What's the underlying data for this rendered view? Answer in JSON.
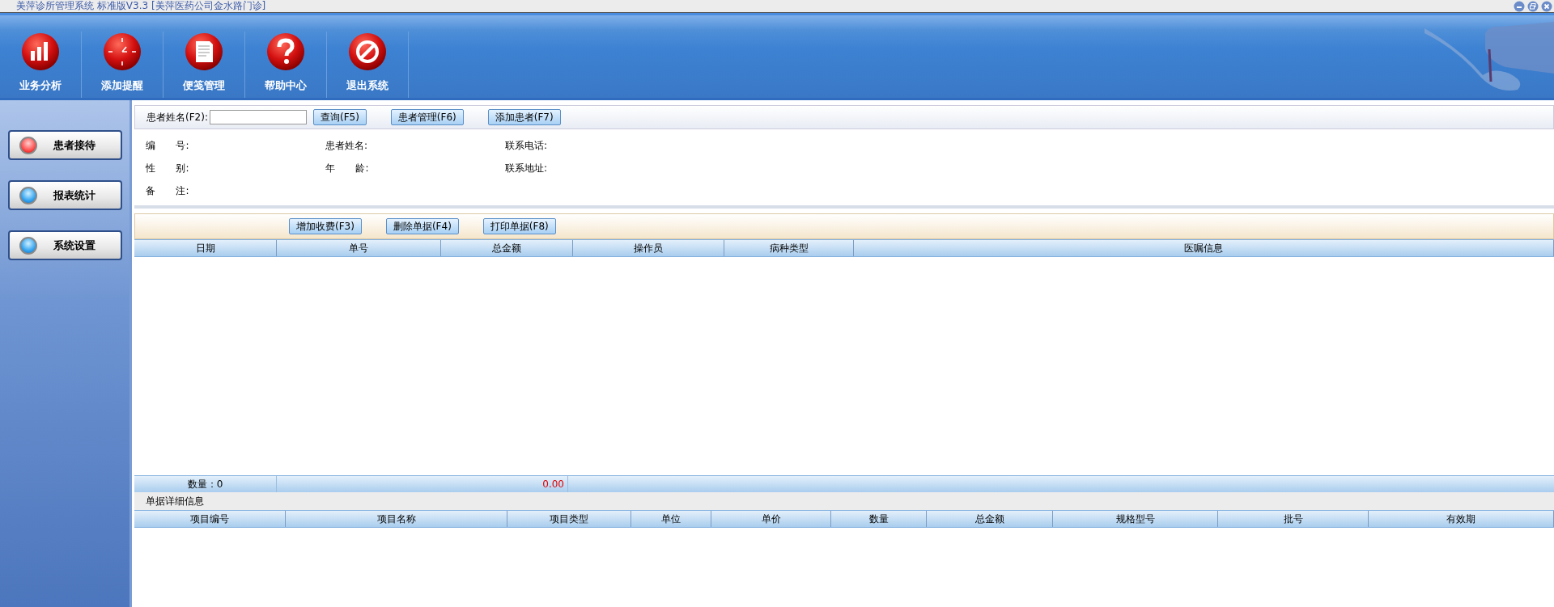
{
  "window": {
    "title": "美萍诊所管理系统 标准版V3.3 [美萍医药公司金水路门诊]"
  },
  "toolbar": {
    "items": [
      {
        "kind": "chart",
        "label": "业务分析"
      },
      {
        "kind": "clock",
        "label": "添加提醒"
      },
      {
        "kind": "note",
        "label": "便笺管理"
      },
      {
        "kind": "help",
        "label": "帮助中心"
      },
      {
        "kind": "exit",
        "label": "退出系统"
      }
    ]
  },
  "sidebar": {
    "items": [
      {
        "label": "患者接待",
        "selected": true
      },
      {
        "label": "报表统计",
        "selected": false
      },
      {
        "label": "系统设置",
        "selected": false
      }
    ]
  },
  "search": {
    "label": "患者姓名(F2):",
    "buttons": [
      "查询(F5)",
      "患者管理(F6)",
      "添加患者(F7)"
    ]
  },
  "patient_info": {
    "fields": [
      {
        "label": "编 号:"
      },
      {
        "label": "患者姓名:"
      },
      {
        "label": "联系电话:"
      },
      {
        "label": "性 别:"
      },
      {
        "label": "年 龄:"
      },
      {
        "label": "联系地址:"
      },
      {
        "label": "备 注:"
      }
    ]
  },
  "charges": {
    "buttons": [
      "增加收费(F3)",
      "删除单据(F4)",
      "打印单据(F8)"
    ],
    "columns": [
      "日期",
      "单号",
      "总金额",
      "操作员",
      "病种类型",
      "医嘱信息"
    ],
    "footer": {
      "count": "数量：0",
      "total": "0.00"
    }
  },
  "detail": {
    "title": "单据详细信息",
    "columns": [
      "项目编号",
      "项目名称",
      "项目类型",
      "单位",
      "单价",
      "数量",
      "总金额",
      "规格型号",
      "批号",
      "有效期"
    ]
  }
}
